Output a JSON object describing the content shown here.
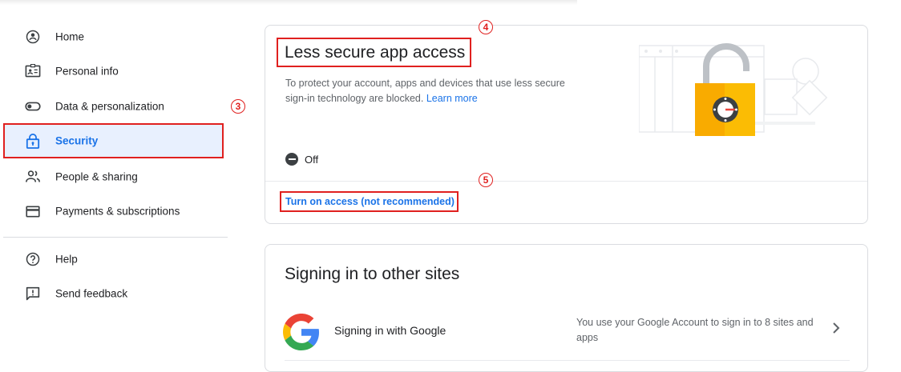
{
  "sidebar": {
    "items": [
      {
        "label": "Home",
        "icon": "home-icon"
      },
      {
        "label": "Personal info",
        "icon": "id-card-icon"
      },
      {
        "label": "Data & personalization",
        "icon": "toggle-icon"
      },
      {
        "label": "Security",
        "icon": "lock-icon",
        "active": true
      },
      {
        "label": "People & sharing",
        "icon": "people-icon"
      },
      {
        "label": "Payments & subscriptions",
        "icon": "credit-card-icon"
      }
    ],
    "secondary": [
      {
        "label": "Help",
        "icon": "help-icon"
      },
      {
        "label": "Send feedback",
        "icon": "feedback-icon"
      }
    ]
  },
  "annotations": {
    "a3": "3",
    "a4": "4",
    "a5": "5"
  },
  "card_less_secure": {
    "title": "Less secure app access",
    "description": "To protect your account, apps and devices that use less secure sign-in technology are blocked.",
    "learn_more": "Learn more",
    "status": "Off",
    "action": "Turn on access (not recommended)"
  },
  "card_signing": {
    "title": "Signing in to other sites",
    "row_label": "Signing in with Google",
    "row_description": "You use your Google Account to sign in to 8 sites and apps"
  },
  "colors": {
    "accent": "#1a73e8",
    "annotation": "#e0201f",
    "active_bg": "#e8f0fe",
    "lock_orange": "#f9ab00"
  }
}
